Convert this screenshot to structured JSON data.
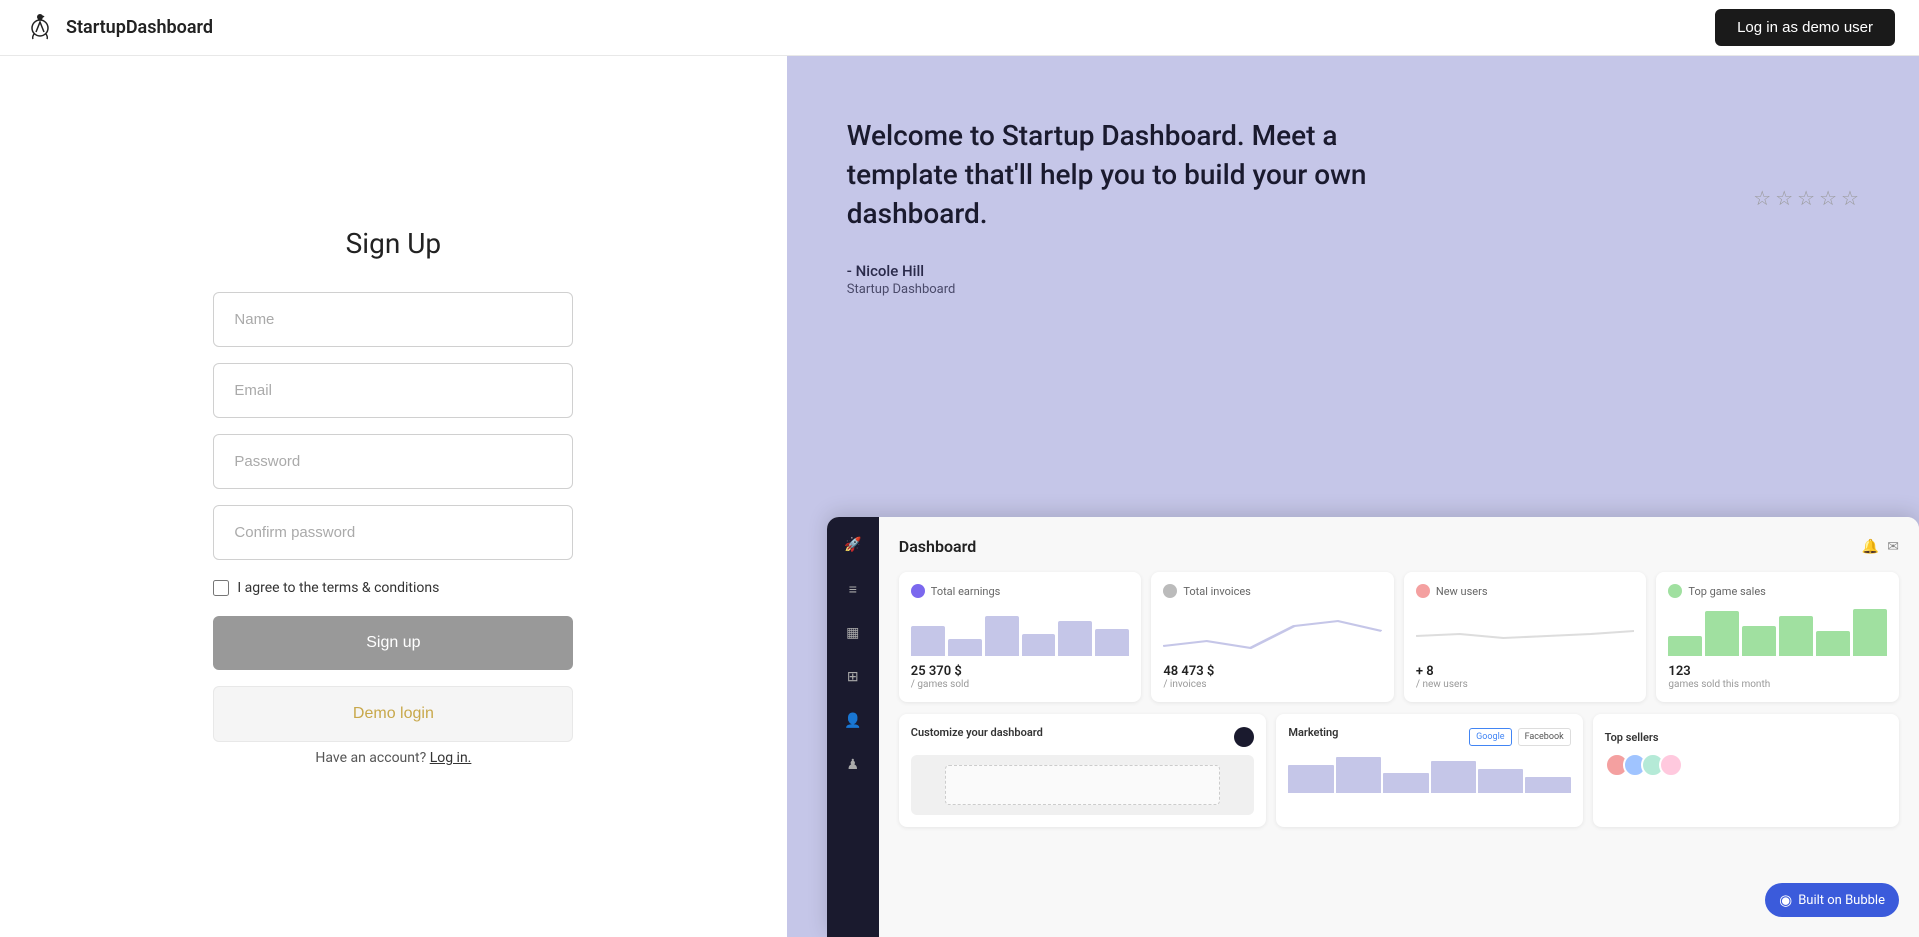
{
  "header": {
    "logo_text": "StartupDashboard",
    "demo_button_label": "Log in as demo user"
  },
  "form": {
    "title": "Sign Up",
    "name_placeholder": "Name",
    "email_placeholder": "Email",
    "password_placeholder": "Password",
    "confirm_password_placeholder": "Confirm password",
    "terms_label": "I agree to the terms & conditions",
    "signup_button": "Sign up",
    "demo_login_button": "Demo login",
    "have_account_text": "Have an account?",
    "login_link": "Log in."
  },
  "right_panel": {
    "welcome_text": "Welcome to Startup Dashboard. Meet a template that'll help you to build your own dashboard.",
    "author_name": "- Nicole Hill",
    "author_title": "Startup Dashboard",
    "stars": [
      "☆",
      "☆",
      "☆",
      "☆",
      "☆"
    ]
  },
  "dashboard_preview": {
    "title": "Dashboard",
    "stats": [
      {
        "label": "Total earnings",
        "icon_color": "#7b68ee",
        "value": "25 370 $",
        "sublabel": "/ games sold",
        "chart_type": "bar",
        "bars": [
          60,
          35,
          80,
          45,
          70,
          55
        ]
      },
      {
        "label": "Total invoices",
        "icon_color": "#aaa",
        "value": "48 473 $",
        "sublabel": "/ invoices",
        "chart_type": "line"
      },
      {
        "label": "New users",
        "icon_color": "#f4a0a0",
        "value": "+ 8",
        "sublabel": "/ new users",
        "chart_type": "line"
      },
      {
        "label": "Top game sales",
        "icon_color": "#a0e0a0",
        "value": "123",
        "sublabel": "games sold this month",
        "chart_type": "bar",
        "bars": [
          40,
          90,
          60,
          80,
          50,
          95
        ]
      }
    ],
    "bottom_cards": [
      {
        "label": "Customize your dashboard",
        "type": "customize"
      },
      {
        "label": "Marketing",
        "type": "marketing",
        "buttons": [
          "Google",
          "Facebook"
        ]
      },
      {
        "label": "Top sellers",
        "type": "sellers"
      }
    ]
  },
  "bubble_badge": {
    "label": "Built on Bubble",
    "icon": "◉"
  }
}
